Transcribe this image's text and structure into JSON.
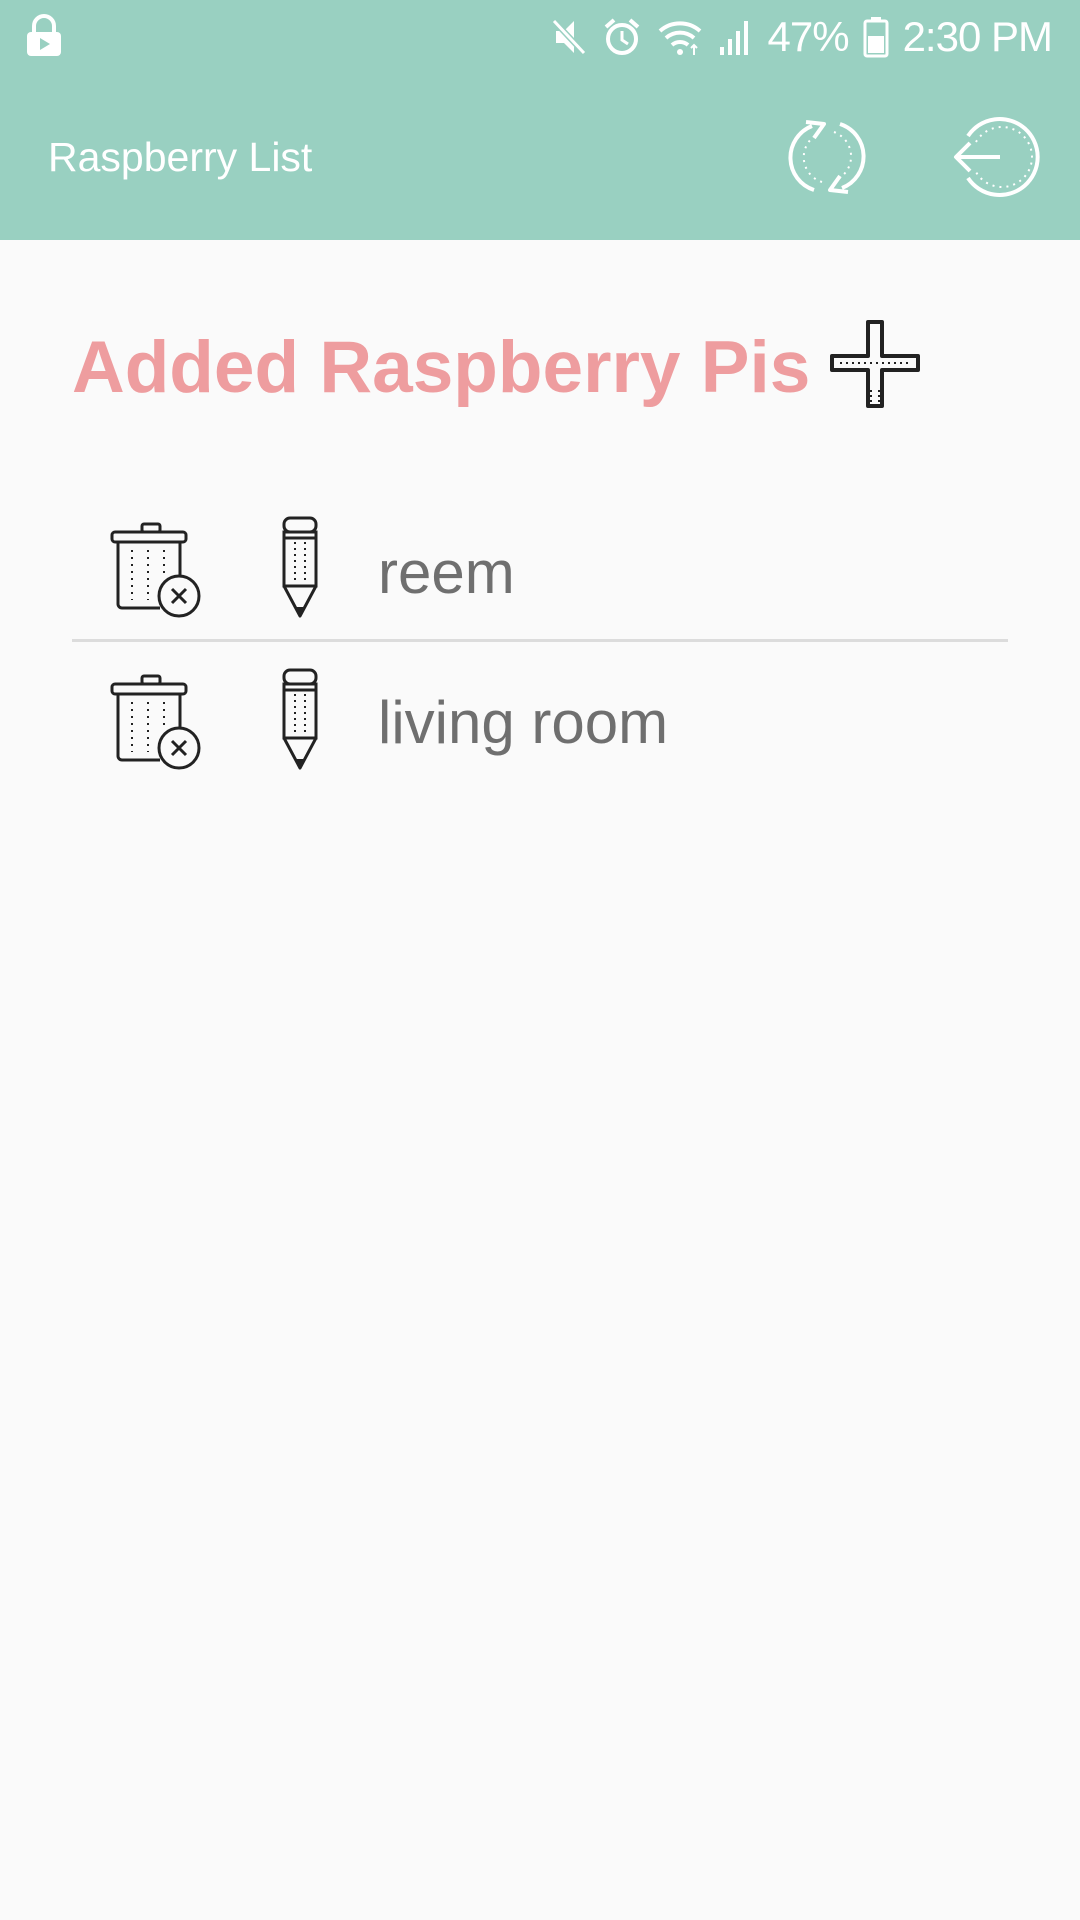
{
  "status_bar": {
    "battery_text": "47%",
    "time": "2:30 PM",
    "icons": [
      "lock-icon",
      "mute-icon",
      "alarm-icon",
      "wifi-icon",
      "signal-icon",
      "battery-icon"
    ]
  },
  "app_bar": {
    "title": "Raspberry List",
    "actions": [
      "refresh-icon",
      "back-icon"
    ]
  },
  "section": {
    "title": "Added Raspberry Pis",
    "add_icon": "plus-icon"
  },
  "devices": [
    {
      "name": "reem"
    },
    {
      "name": "living room"
    }
  ],
  "colors": {
    "app_bar": "#99d0c1",
    "heading": "#ee9d9f",
    "item_text": "#6f6f6f",
    "background": "#fafafa",
    "divider": "#dcdcdc"
  }
}
